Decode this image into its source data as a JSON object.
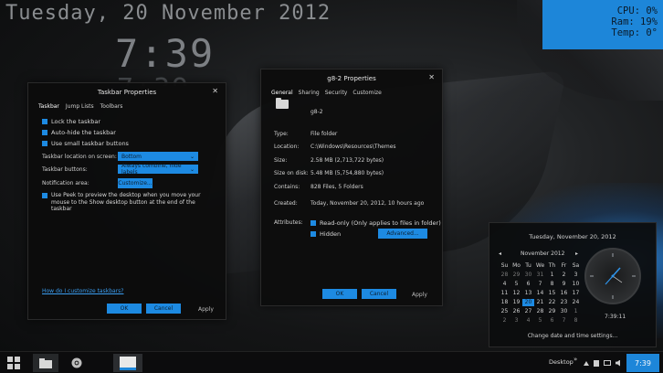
{
  "desktop": {
    "date": "Tuesday, 20 November 2012",
    "time": "7:39",
    "stats": {
      "cpu": "CPU: 0%",
      "ram": "Ram: 19%",
      "temp": "Temp: 0°"
    }
  },
  "taskbar_props": {
    "title": "Taskbar Properties",
    "close": "✕",
    "tabs": [
      "Taskbar",
      "Jump Lists",
      "Toolbars"
    ],
    "checks": [
      "Lock the taskbar",
      "Auto-hide the taskbar",
      "Use small taskbar buttons"
    ],
    "location_label": "Taskbar location on screen:",
    "location_value": "Bottom",
    "buttons_label": "Taskbar buttons:",
    "buttons_value": "Always combine, hide labels",
    "notif_label": "Notification area:",
    "customize_btn": "Customize...",
    "peek_text": "Use Peek to preview the desktop when you move your mouse to the Show desktop button at the end of the taskbar",
    "how_link": "How do I customize taskbars?",
    "ok": "OK",
    "cancel": "Cancel",
    "apply": "Apply",
    "chevron": "⌄"
  },
  "g8_props": {
    "title": "g8-2 Properties",
    "close": "✕",
    "tabs": [
      "General",
      "Sharing",
      "Security",
      "Customize"
    ],
    "name": "g8-2",
    "rows": [
      {
        "label": "Type:",
        "value": "File folder"
      },
      {
        "label": "Location:",
        "value": "C:\\Windows\\Resources\\Themes"
      },
      {
        "label": "Size:",
        "value": "2.58 MB (2,713,722 bytes)"
      },
      {
        "label": "Size on disk:",
        "value": "5.48 MB (5,754,880 bytes)"
      },
      {
        "label": "Contains:",
        "value": "828 Files, 5 Folders"
      },
      {
        "label": "Created:",
        "value": "Today, November 20, 2012, 10 hours ago"
      }
    ],
    "attributes_label": "Attributes:",
    "readonly": "Read-only (Only applies to files in folder)",
    "hidden": "Hidden",
    "advanced": "Advanced...",
    "ok": "OK",
    "cancel": "Cancel",
    "apply": "Apply"
  },
  "calendar": {
    "header": "Tuesday, November 20, 2012",
    "month": "November 2012",
    "prev": "◂",
    "next": "▸",
    "weekdays": [
      "Su",
      "Mo",
      "Tu",
      "We",
      "Th",
      "Fr",
      "Sa"
    ],
    "days": [
      "28",
      "29",
      "30",
      "31",
      "1",
      "2",
      "3",
      "4",
      "5",
      "6",
      "7",
      "8",
      "9",
      "10",
      "11",
      "12",
      "13",
      "14",
      "15",
      "16",
      "17",
      "18",
      "19",
      "20",
      "21",
      "22",
      "23",
      "24",
      "25",
      "26",
      "27",
      "28",
      "29",
      "30",
      "1",
      "2",
      "3",
      "4",
      "5",
      "6",
      "7",
      "8"
    ],
    "clock_time": "7:39:11",
    "change_link": "Change date and time settings..."
  },
  "taskbar": {
    "desktop_label": "Desktop",
    "chevron": "»",
    "clock": "7:39"
  }
}
